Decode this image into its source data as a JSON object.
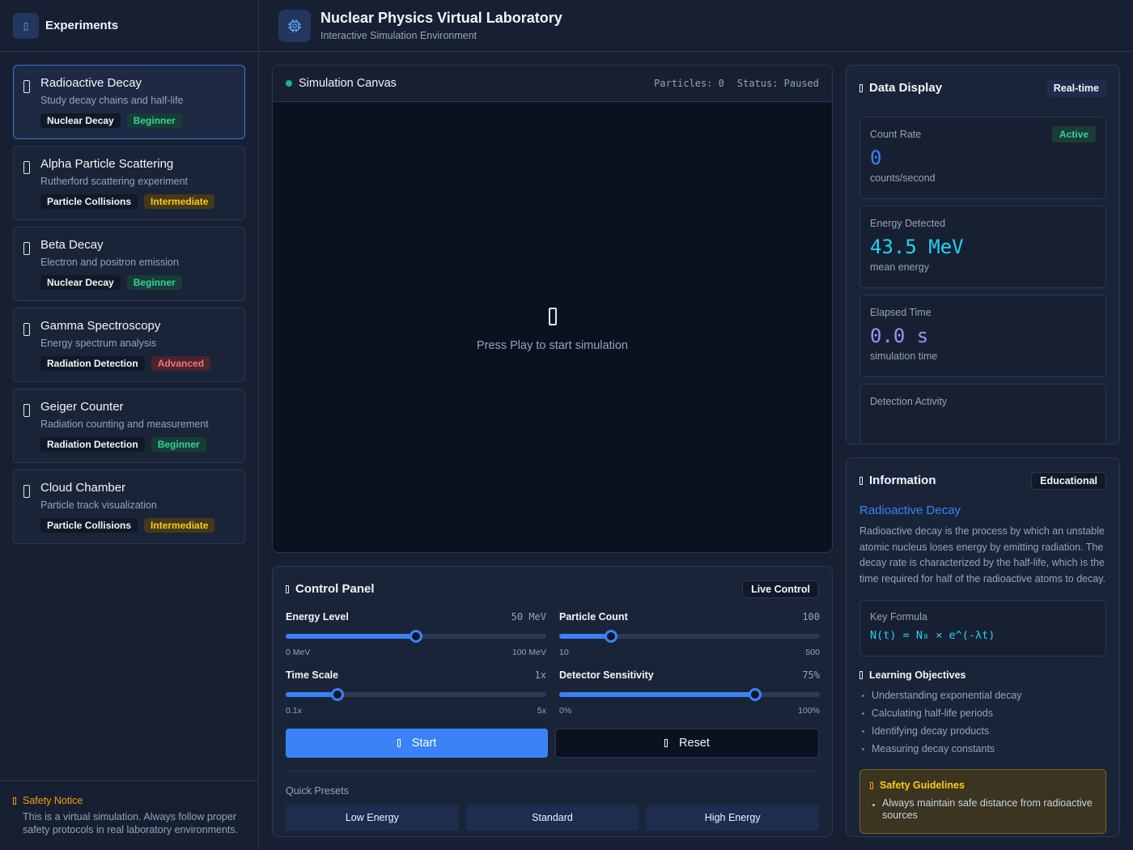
{
  "sidebar": {
    "title": "Experiments",
    "experiments": [
      {
        "name": "Radioactive Decay",
        "desc": "Study decay chains and half-life",
        "category": "Nuclear Decay",
        "level": "Beginner"
      },
      {
        "name": "Alpha Particle Scattering",
        "desc": "Rutherford scattering experiment",
        "category": "Particle Collisions",
        "level": "Intermediate"
      },
      {
        "name": "Beta Decay",
        "desc": "Electron and positron emission",
        "category": "Nuclear Decay",
        "level": "Beginner"
      },
      {
        "name": "Gamma Spectroscopy",
        "desc": "Energy spectrum analysis",
        "category": "Radiation Detection",
        "level": "Advanced"
      },
      {
        "name": "Geiger Counter",
        "desc": "Radiation counting and measurement",
        "category": "Radiation Detection",
        "level": "Beginner"
      },
      {
        "name": "Cloud Chamber",
        "desc": "Particle track visualization",
        "category": "Particle Collisions",
        "level": "Intermediate"
      }
    ],
    "notice": {
      "title": "Safety Notice",
      "text": "This is a virtual simulation. Always follow proper safety protocols in real laboratory environments."
    }
  },
  "header": {
    "title": "Nuclear Physics Virtual Laboratory",
    "subtitle": "Interactive Simulation Environment"
  },
  "canvas": {
    "title": "Simulation Canvas",
    "particles": "Particles: 0",
    "status": "Status: Paused",
    "prompt": "Press Play to start simulation"
  },
  "controls": {
    "title": "Control Panel",
    "badge": "Live Control",
    "sliders": [
      {
        "label": "Energy Level",
        "value": "50 MeV",
        "min": "0 MeV",
        "max": "100 MeV",
        "fraction": 0.5
      },
      {
        "label": "Particle Count",
        "value": "100",
        "min": "10",
        "max": "500",
        "fraction": 0.2
      },
      {
        "label": "Time Scale",
        "value": "1x",
        "min": "0.1x",
        "max": "5x",
        "fraction": 0.2
      },
      {
        "label": "Detector Sensitivity",
        "value": "75%",
        "min": "0%",
        "max": "100%",
        "fraction": 0.75
      }
    ],
    "start_label": "Start",
    "reset_label": "Reset",
    "presets_label": "Quick Presets",
    "presets": [
      "Low Energy",
      "Standard",
      "High Energy"
    ]
  },
  "data_display": {
    "title": "Data Display",
    "badge": "Real-time",
    "count_rate": {
      "label": "Count Rate",
      "value": "0",
      "unit": "counts/second",
      "status": "Active"
    },
    "energy": {
      "label": "Energy Detected",
      "value": "43.5 MeV",
      "unit": "mean energy"
    },
    "elapsed": {
      "label": "Elapsed Time",
      "value": "0.0 s",
      "unit": "simulation time"
    },
    "activity": {
      "label": "Detection Activity"
    }
  },
  "information": {
    "title": "Information",
    "badge": "Educational",
    "name": "Radioactive Decay",
    "text": "Radioactive decay is the process by which an unstable atomic nucleus loses energy by emitting radiation. The decay rate is characterized by the half-life, which is the time required for half of the radioactive atoms to decay.",
    "formula_label": "Key Formula",
    "formula": "N(t) = N₀ × e^(-λt)",
    "objectives_title": "Learning Objectives",
    "objectives": [
      "Understanding exponential decay",
      "Calculating half-life periods",
      "Identifying decay products",
      "Measuring decay constants"
    ],
    "safety_title": "Safety Guidelines",
    "safety_items": [
      "Always maintain safe distance from radioactive sources"
    ]
  },
  "colors": {
    "accent": "#3b82f6",
    "count_rate": "#3b82f6",
    "energy": "#22d3ee",
    "elapsed": "#a78bfa",
    "success": "#34d399",
    "warning": "#facc15",
    "danger": "#f87171"
  },
  "icons": {
    "header": "cpu-chip-icon",
    "sidebar": "flask-icon",
    "canvas_center": "play-icon"
  }
}
